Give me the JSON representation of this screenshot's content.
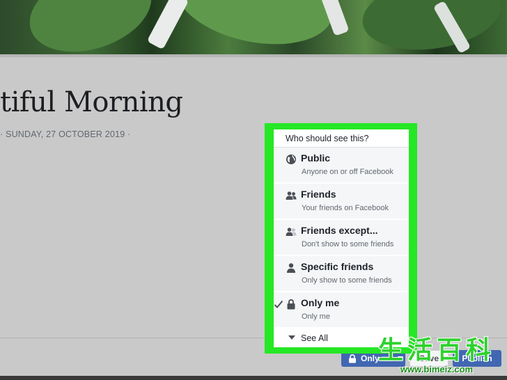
{
  "post": {
    "title": "tiful Morning",
    "meta": "· SUNDAY, 27 OCTOBER 2019 ·"
  },
  "privacy_menu": {
    "header": "Who should see this?",
    "options": [
      {
        "label": "Public",
        "description": "Anyone on or off Facebook",
        "icon": "globe-icon",
        "selected": false
      },
      {
        "label": "Friends",
        "description": "Your friends on Facebook",
        "icon": "friends-icon",
        "selected": false
      },
      {
        "label": "Friends except...",
        "description": "Don't show to some friends",
        "icon": "friends-except-icon",
        "selected": false
      },
      {
        "label": "Specific friends",
        "description": "Only show to some friends",
        "icon": "person-icon",
        "selected": false
      },
      {
        "label": "Only me",
        "description": "Only me",
        "icon": "lock-icon",
        "selected": true
      }
    ],
    "see_all": "See All"
  },
  "footer": {
    "privacy_button": "Only me",
    "save_button": "Save",
    "publish_button": "Publish"
  },
  "watermark": {
    "chars": "生活百科",
    "url": "www.bimeiz.com"
  },
  "colors": {
    "highlight": "#25e825",
    "brand_blue": "#4267b2"
  }
}
